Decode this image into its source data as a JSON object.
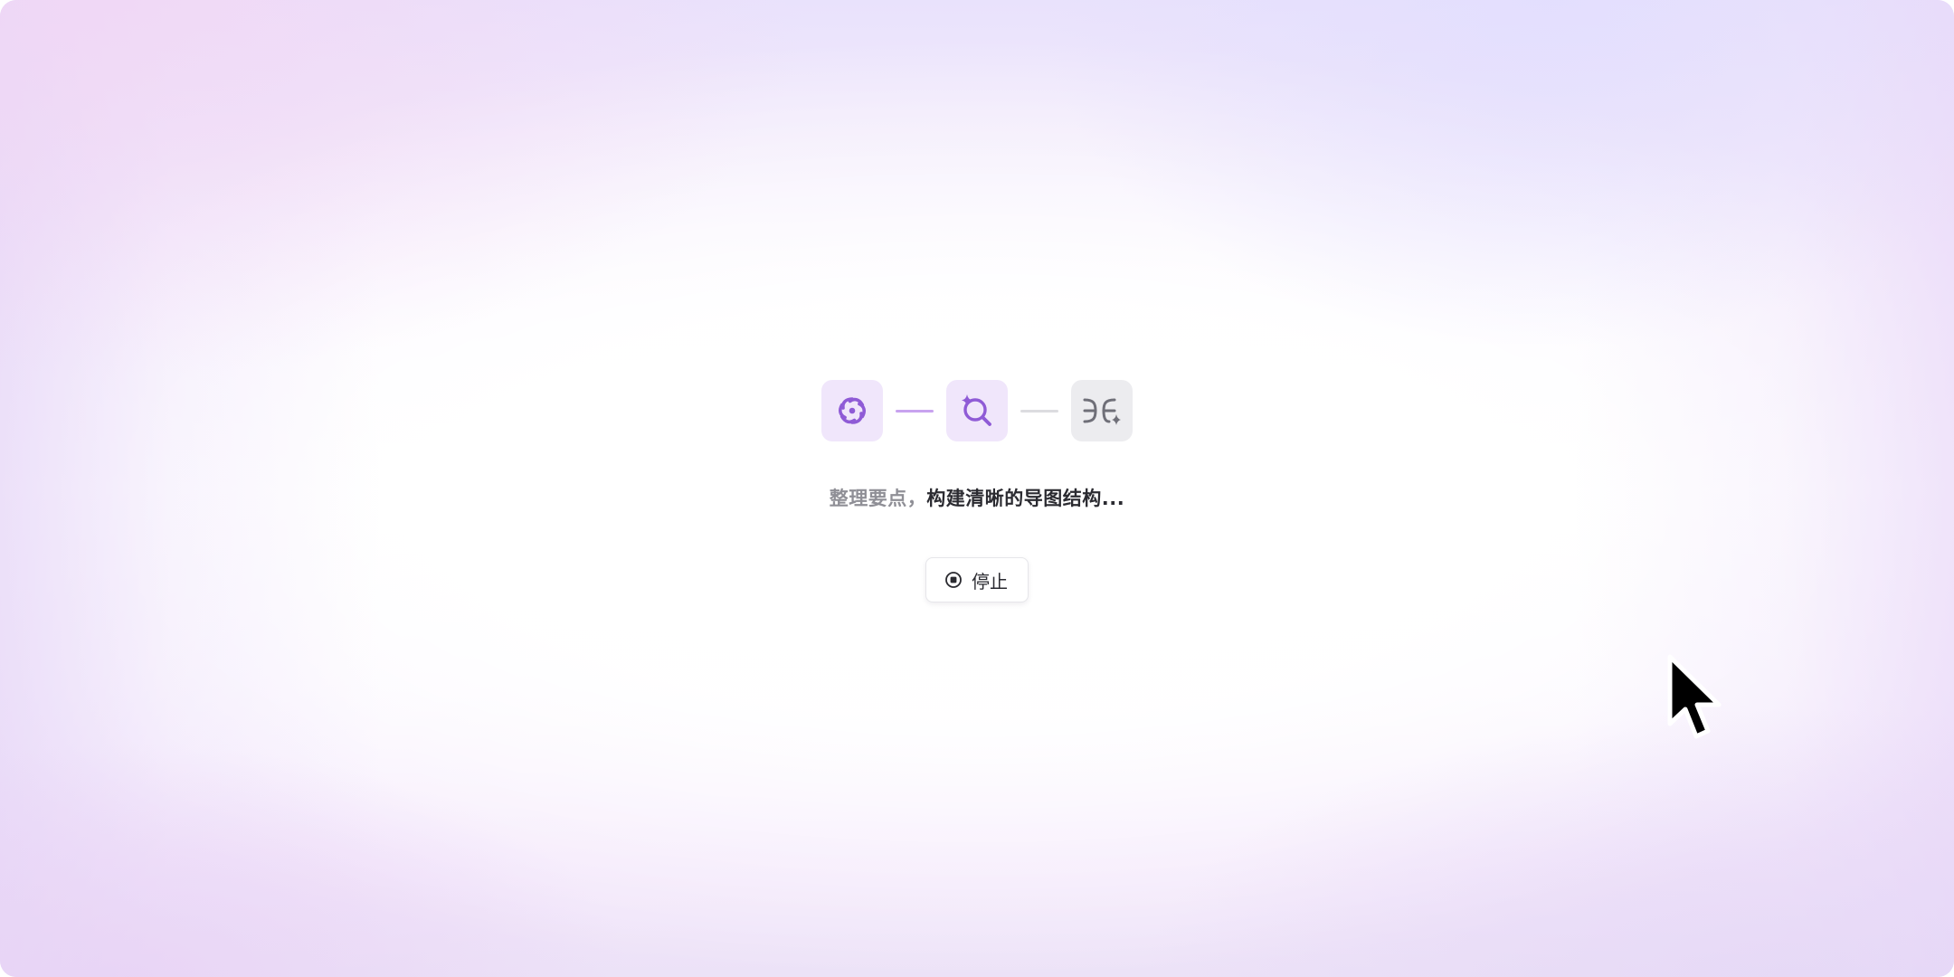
{
  "progress": {
    "steps": [
      {
        "icon": "swirl-icon",
        "state": "done"
      },
      {
        "icon": "sparkle-search-icon",
        "state": "active"
      },
      {
        "icon": "mindmap-sparkle-icon",
        "state": "pending"
      }
    ]
  },
  "status": {
    "dim_text": "整理要点，",
    "strong_text": "构建清晰的导图结构..."
  },
  "stop_button": {
    "label": "停止",
    "icon": "stop-circle-icon"
  },
  "colors": {
    "accent": "#8f5bd6",
    "accent_bg": "#f0e6fb",
    "pending_bg": "#ececef",
    "pending_icon": "#6f6f78"
  }
}
